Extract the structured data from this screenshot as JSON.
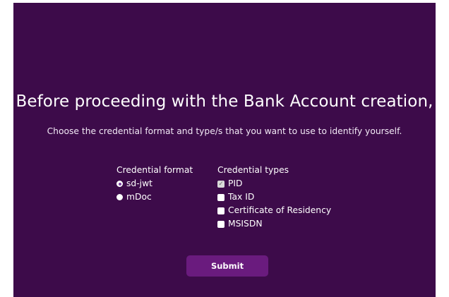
{
  "heading": "Before proceeding with the Bank Account creation,",
  "subtitle": "Choose the credential format and type/s that you want to use to identify yourself.",
  "credential_format": {
    "title": "Credential format",
    "options": [
      {
        "label": "sd-jwt",
        "selected": true
      },
      {
        "label": "mDoc",
        "selected": false
      }
    ]
  },
  "credential_types": {
    "title": "Credential types",
    "options": [
      {
        "label": "PID",
        "checked": true
      },
      {
        "label": "Tax ID",
        "checked": false
      },
      {
        "label": "Certificate of Residency",
        "checked": false
      },
      {
        "label": "MSISDN",
        "checked": false
      }
    ]
  },
  "submit_label": "Submit",
  "colors": {
    "panel_background": "#3d0b4a",
    "submit_background": "#6a1b7e",
    "text": "#ffffff"
  }
}
